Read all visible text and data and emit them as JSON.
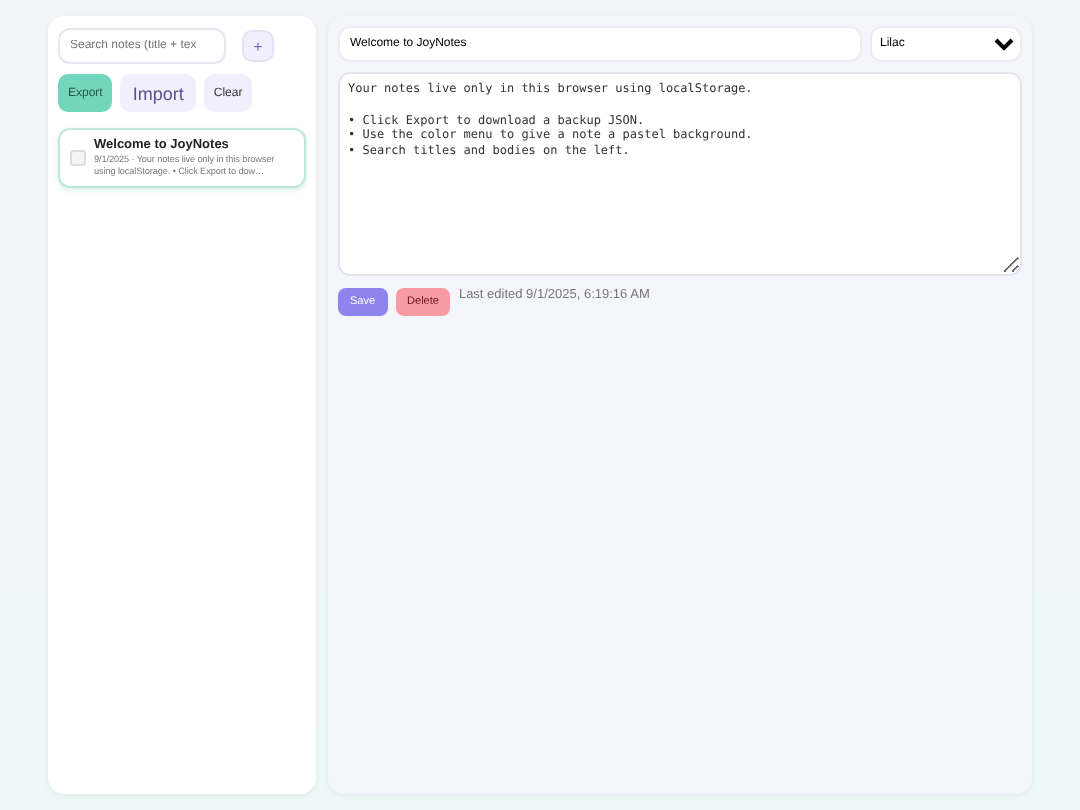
{
  "sidebar": {
    "search": {
      "placeholder": "Search notes (title + tex"
    },
    "add_button": "+",
    "buttons": [
      {
        "label": "Export",
        "kind": "primary"
      },
      {
        "label": "Import",
        "kind": "large"
      },
      {
        "label": "Clear",
        "kind": "plain"
      }
    ],
    "notes": [
      {
        "title": "Welcome to JoyNotes",
        "snippet": "9/1/2025 · Your notes live only in this browser using localStorage. • Click Export to dow…",
        "checked": false,
        "selected": true
      }
    ]
  },
  "editor": {
    "title": "Welcome to JoyNotes",
    "color_menu": "Lilac",
    "body": "Your notes live only in this browser using localStorage.\n\n• Click Export to download a backup JSON.\n• Use the color menu to give a note a pastel background.\n• Search titles and bodies on the left.",
    "save": "Save",
    "delete": "Delete",
    "last_edited": "Last edited 9/1/2025, 6:19:16 AM"
  }
}
